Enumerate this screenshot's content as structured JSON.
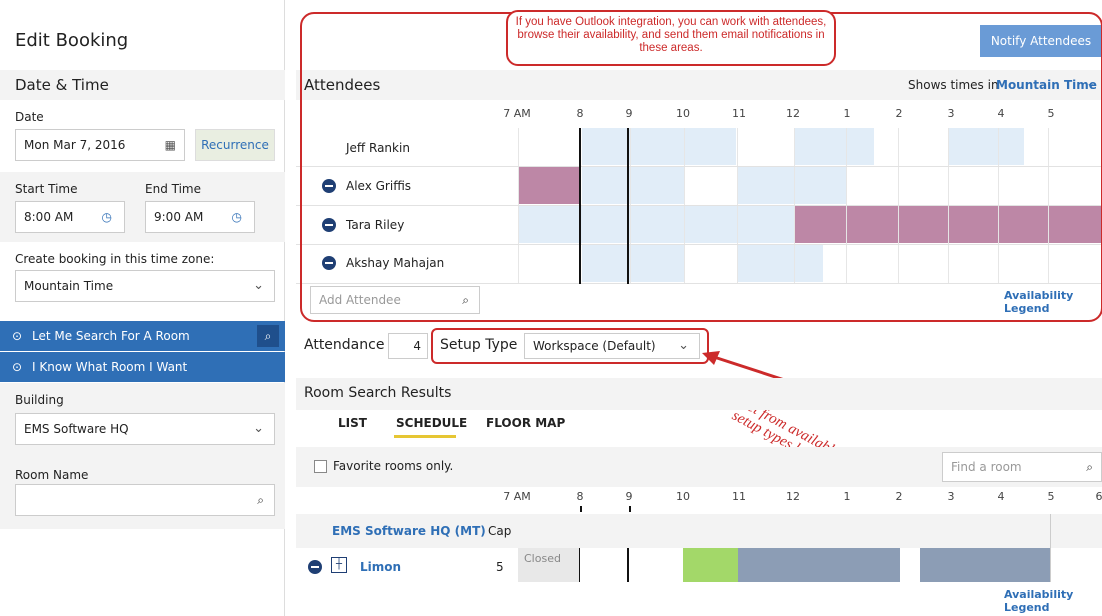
{
  "left": {
    "title": "Edit Booking",
    "date_time_heading": "Date & Time",
    "date_label": "Date",
    "date_value": "Mon Mar 7, 2016",
    "recurrence_label": "Recurrence",
    "start_label": "Start Time",
    "start_value": "8:00 AM",
    "end_label": "End Time",
    "end_value": "9:00 AM",
    "tz_label": "Create booking in this time zone:",
    "tz_value": "Mountain Time",
    "search_room_label": "Let Me Search For A Room",
    "know_room_label": "I Know What Room I Want",
    "building_label": "Building",
    "building_value": "EMS Software HQ",
    "room_name_label": "Room Name",
    "room_name_value": ""
  },
  "top": {
    "notify_button": "Notify Attendees",
    "callout_text": "If you have Outlook integration, you can work with attendees, browse their availability, and send them email notifications in these areas."
  },
  "attendees": {
    "heading": "Attendees",
    "shows_times_in": "Shows times in",
    "timezone": "Mountain Time",
    "times": [
      "7 AM",
      "8",
      "9",
      "10",
      "11",
      "12",
      "1",
      "2",
      "3",
      "4",
      "5"
    ],
    "people": [
      {
        "name": "Jeff Rankin",
        "removable": false
      },
      {
        "name": "Alex Griffis",
        "removable": true
      },
      {
        "name": "Tara Riley",
        "removable": true
      },
      {
        "name": "Akshay Mahajan",
        "removable": true
      }
    ],
    "add_placeholder": "Add Attendee",
    "legend_link": "Availability Legend"
  },
  "setup": {
    "attendance_label": "Attendance",
    "attendance_value": "4",
    "setup_type_label": "Setup Type",
    "setup_type_value": "Workspace (Default)",
    "annotation": "Select from available setup types here"
  },
  "results": {
    "heading": "Room Search Results",
    "tabs": [
      "LIST",
      "SCHEDULE",
      "FLOOR MAP"
    ],
    "active_tab": "SCHEDULE",
    "favorites_label": "Favorite rooms only.",
    "find_placeholder": "Find a room",
    "times": [
      "7 AM",
      "8",
      "9",
      "10",
      "11",
      "12",
      "1",
      "2",
      "3",
      "4",
      "5",
      "6"
    ],
    "building_name": "EMS Software HQ (MT)",
    "cap_label": "Cap",
    "room_name": "Limon",
    "room_cap": "5",
    "closed_label": "Closed",
    "legend_link": "Availability Legend"
  },
  "colors": {
    "accent": "#2f6fb6",
    "busy": "#bd87a6",
    "tentative": "#e1edf8",
    "available": "#a3d869",
    "booked": "#8c9db5",
    "callout": "#cc2a2a"
  }
}
